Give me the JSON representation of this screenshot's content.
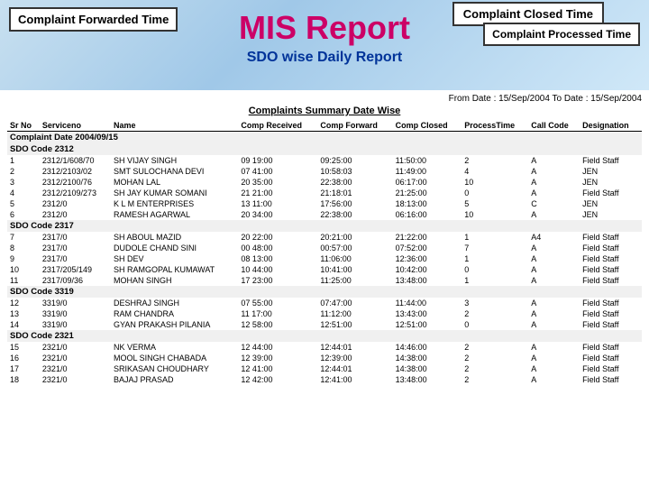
{
  "header": {
    "mis_title": "MIS Report",
    "sdo_subtitle": "SDO wise Daily Report",
    "complaint_forwarded_label": "Complaint Forwarded Time",
    "complaint_closed_label": "Complaint Closed Time",
    "complaint_processed_label": "Complaint Processed Time"
  },
  "report": {
    "date_range": "From Date : 15/Sep/2004  To Date : 15/Sep/2004",
    "summary_label": "Complaints Summary Date Wise",
    "columns": [
      "Sr No",
      "Serviceno",
      "Name",
      "Comp Received",
      "Comp Forward",
      "Comp Closed",
      "ProcessTime",
      "Call Code",
      "Designation"
    ],
    "sections": [
      {
        "complaint_date": "Complaint Date  2004/09/15",
        "sdo_code": "SDO Code    2312",
        "rows": [
          {
            "sr": "1",
            "service": "2312/1/608/70",
            "name": "SH VIJAY SINGH",
            "received": "09 19:00",
            "forward": "09:25:00",
            "closed": "11:50:00",
            "process": "2",
            "call_code": "A",
            "designation": "Field Staff"
          },
          {
            "sr": "2",
            "service": "2312/2103/02",
            "name": "SMT SULOCHANA DEVI",
            "received": "07 41:00",
            "forward": "10:58:03",
            "closed": "11:49:00",
            "process": "4",
            "call_code": "A",
            "designation": "JEN"
          },
          {
            "sr": "3",
            "service": "2312/2100/76",
            "name": "MOHAN LAL",
            "received": "20 35:00",
            "forward": "22:38:00",
            "closed": "06:17:00",
            "process": "10",
            "call_code": "A",
            "designation": "JEN"
          },
          {
            "sr": "4",
            "service": "2312/2109/273",
            "name": "SH JAY KUMAR SOMANI",
            "received": "21 21:00",
            "forward": "21:18:01",
            "closed": "21:25:00",
            "process": "0",
            "call_code": "A",
            "designation": "Field Staff"
          },
          {
            "sr": "5",
            "service": "2312/0",
            "name": "K L M ENTERPRISES",
            "received": "13 11:00",
            "forward": "17:56:00",
            "closed": "18:13:00",
            "process": "5",
            "call_code": "C",
            "designation": "JEN"
          },
          {
            "sr": "6",
            "service": "2312/0",
            "name": "RAMESH AGARWAL",
            "received": "20 34:00",
            "forward": "22:38:00",
            "closed": "06:16:00",
            "process": "10",
            "call_code": "A",
            "designation": "JEN"
          }
        ]
      },
      {
        "sdo_code": "SDO Code    2317",
        "rows": [
          {
            "sr": "7",
            "service": "2317/0",
            "name": "SH ABOUL MAZID",
            "received": "20 22:00",
            "forward": "20:21:00",
            "closed": "21:22:00",
            "process": "1",
            "call_code": "A4",
            "designation": "Field Staff"
          },
          {
            "sr": "8",
            "service": "2317/0",
            "name": "DUDOLE CHAND SINI",
            "received": "00 48:00",
            "forward": "00:57:00",
            "closed": "07:52:00",
            "process": "7",
            "call_code": "A",
            "designation": "Field Staff"
          },
          {
            "sr": "9",
            "service": "2317/0",
            "name": "SH DEV",
            "received": "08 13:00",
            "forward": "11:06:00",
            "closed": "12:36:00",
            "process": "1",
            "call_code": "A",
            "designation": "Field Staff"
          },
          {
            "sr": "10",
            "service": "2317/205/149",
            "name": "SH RAMGOPAL KUMAWAT",
            "received": "10 44:00",
            "forward": "10:41:00",
            "closed": "10:42:00",
            "process": "0",
            "call_code": "A",
            "designation": "Field Staff"
          },
          {
            "sr": "11",
            "service": "2317/09/36",
            "name": "MOHAN SINGH",
            "received": "17 23:00",
            "forward": "11:25:00",
            "closed": "13:48:00",
            "process": "1",
            "call_code": "A",
            "designation": "Field Staff"
          }
        ]
      },
      {
        "sdo_code": "SDO Code    3319",
        "rows": [
          {
            "sr": "12",
            "service": "3319/0",
            "name": "DESHRAJ SINGH",
            "received": "07 55:00",
            "forward": "07:47:00",
            "closed": "11:44:00",
            "process": "3",
            "call_code": "A",
            "designation": "Field Staff"
          },
          {
            "sr": "13",
            "service": "3319/0",
            "name": "RAM CHANDRA",
            "received": "11 17:00",
            "forward": "11:12:00",
            "closed": "13:43:00",
            "process": "2",
            "call_code": "A",
            "designation": "Field Staff"
          },
          {
            "sr": "14",
            "service": "3319/0",
            "name": "GYAN PRAKASH PILANIA",
            "received": "12 58:00",
            "forward": "12:51:00",
            "closed": "12:51:00",
            "process": "0",
            "call_code": "A",
            "designation": "Field Staff"
          }
        ]
      },
      {
        "sdo_code": "SDO Code    2321",
        "rows": [
          {
            "sr": "15",
            "service": "2321/0",
            "name": "NK VERMA",
            "received": "12 44:00",
            "forward": "12:44:01",
            "closed": "14:46:00",
            "process": "2",
            "call_code": "A",
            "designation": "Field Staff"
          },
          {
            "sr": "16",
            "service": "2321/0",
            "name": "MOOL SINGH CHABADA",
            "received": "12 39:00",
            "forward": "12:39:00",
            "closed": "14:38:00",
            "process": "2",
            "call_code": "A",
            "designation": "Field Staff"
          },
          {
            "sr": "17",
            "service": "2321/0",
            "name": "SRIKASAN CHOUDHARY",
            "received": "12 41:00",
            "forward": "12:44:01",
            "closed": "14:38:00",
            "process": "2",
            "call_code": "A",
            "designation": "Field Staff"
          },
          {
            "sr": "18",
            "service": "2321/0",
            "name": "BAJAJ PRASAD",
            "received": "12 42:00",
            "forward": "12:41:00",
            "closed": "13:48:00",
            "process": "2",
            "call_code": "A",
            "designation": "Field Staff"
          }
        ]
      }
    ]
  }
}
